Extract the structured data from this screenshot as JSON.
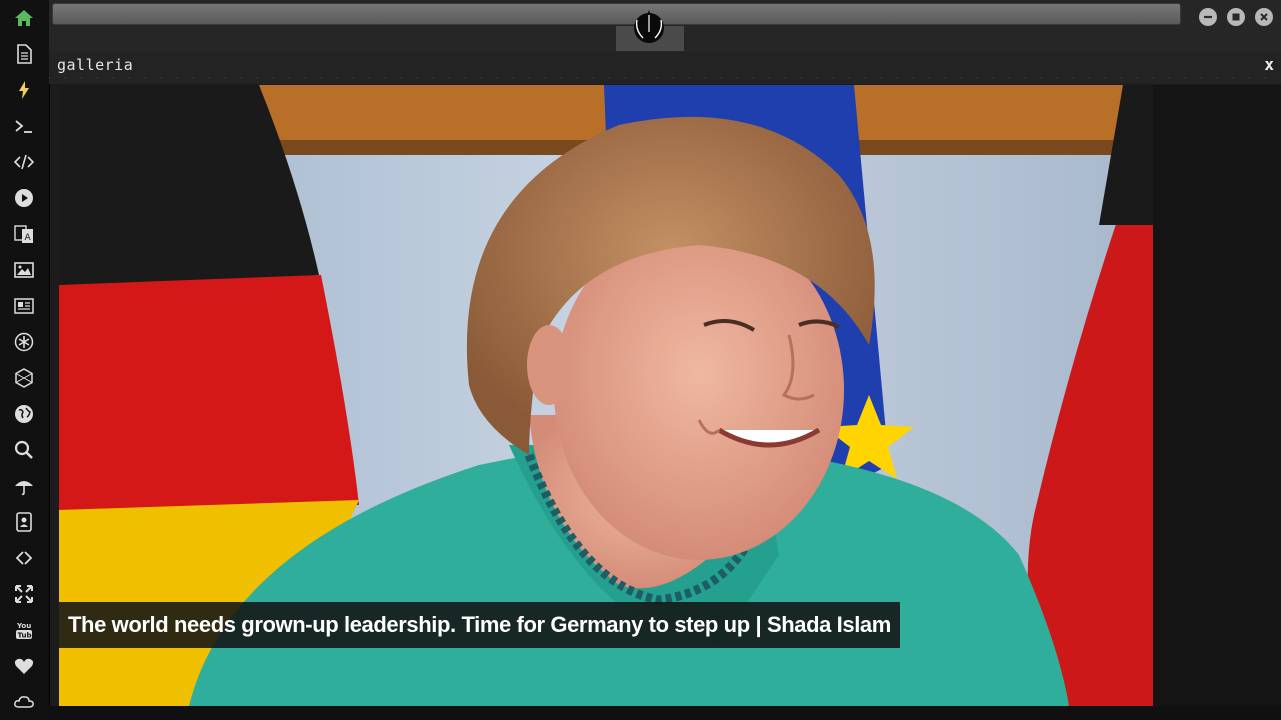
{
  "panel": {
    "title": "galleria",
    "close_label": "x"
  },
  "caption": {
    "text": "The world needs grown-up leadership. Time for Germany to step up | Shada Islam"
  },
  "sidebar": {
    "items": [
      {
        "icon": "home-icon",
        "color": "#5cb85c"
      },
      {
        "icon": "document-icon"
      },
      {
        "icon": "lightning-icon"
      },
      {
        "icon": "terminal-icon"
      },
      {
        "icon": "code-icon"
      },
      {
        "icon": "play-icon"
      },
      {
        "icon": "translate-icon"
      },
      {
        "icon": "image-icon"
      },
      {
        "icon": "newspaper-icon"
      },
      {
        "icon": "asterisk-icon"
      },
      {
        "icon": "hexagon-icon"
      },
      {
        "icon": "globe-icon"
      },
      {
        "icon": "search-icon"
      },
      {
        "icon": "umbrella-icon"
      },
      {
        "icon": "contact-icon"
      },
      {
        "icon": "link-icon"
      },
      {
        "icon": "expand-icon"
      },
      {
        "icon": "youtube-icon"
      },
      {
        "icon": "heart-icon"
      },
      {
        "icon": "cloud-icon"
      }
    ]
  },
  "window_controls": [
    "minimize-icon",
    "maximize-icon",
    "close-icon"
  ]
}
